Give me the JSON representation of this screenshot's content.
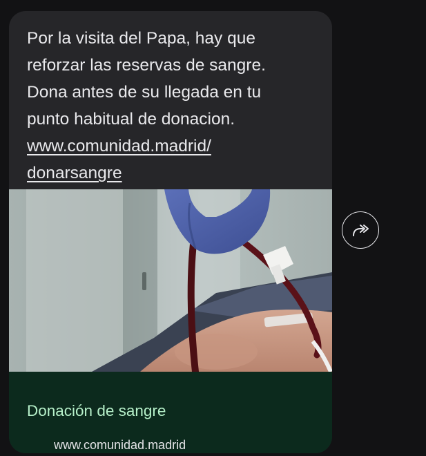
{
  "message": {
    "lines": [
      "Por la visita del Papa, hay que",
      "reforzar las reservas de sangre.",
      "Dona antes de su llegada en tu",
      "punto habitual de donacion."
    ],
    "link_lines": [
      "www.comunidad.madrid/",
      "donarsangre"
    ]
  },
  "link_preview": {
    "title": "Donación de sangre",
    "domain": "www.comunidad.madrid",
    "image_icon": "blood-donation-photo"
  },
  "actions": {
    "share_icon": "share-forward-icon"
  },
  "colors": {
    "background": "#121214",
    "bubble": "#262629",
    "preview_footer": "#0c2a1d",
    "preview_title": "#b6f0c9"
  }
}
